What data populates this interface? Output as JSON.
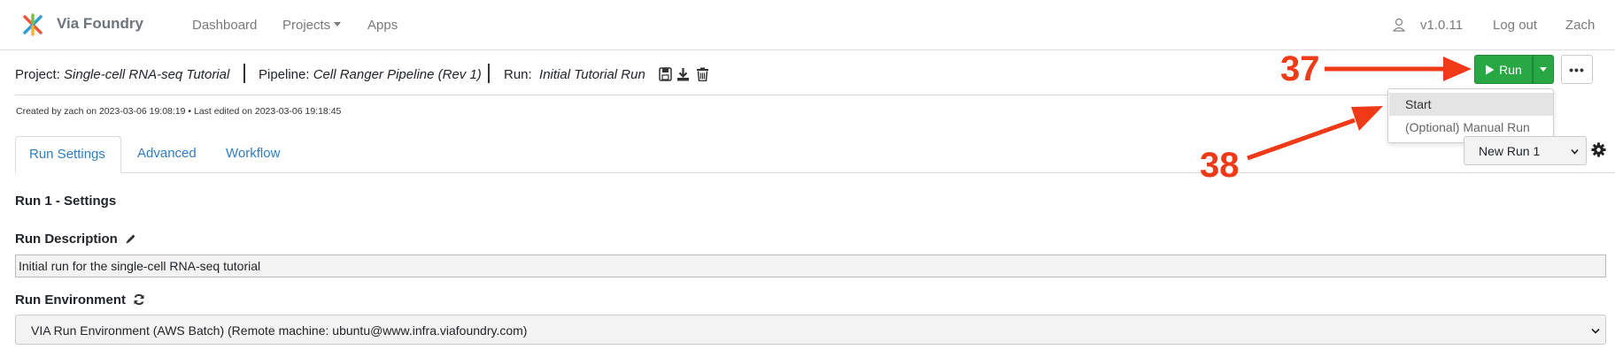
{
  "navbar": {
    "brand": "Via Foundry",
    "links": [
      "Dashboard",
      "Projects",
      "Apps"
    ],
    "version": "v1.0.11",
    "logout": "Log out",
    "user": "Zach"
  },
  "header": {
    "project_label": "Project:",
    "project_name": "Single-cell RNA-seq Tutorial",
    "pipeline_label": "Pipeline:",
    "pipeline_name": "Cell Ranger Pipeline (Rev 1)",
    "run_label": "Run:",
    "run_name": "Initial Tutorial Run",
    "meta": "Created by zach on 2023-03-06 19:08:19 • Last edited on 2023-03-06 19:18:45"
  },
  "run_button": {
    "label": "Run",
    "more": "•••"
  },
  "run_dropdown": {
    "items": [
      "Start",
      "(Optional) Manual Run"
    ],
    "highlighted": "Start"
  },
  "tabs": [
    "Run Settings",
    "Advanced",
    "Workflow"
  ],
  "active_tab": "Run Settings",
  "run_select": {
    "value": "New Run 1"
  },
  "settings": {
    "title": "Run 1 - Settings",
    "description_label": "Run Description",
    "description_value": "Initial run for the single-cell RNA-seq tutorial",
    "environment_label": "Run Environment",
    "environment_value": "VIA Run Environment (AWS Batch) (Remote machine: ubuntu@www.infra.viafoundry.com)"
  },
  "annotations": [
    "37",
    "38"
  ],
  "colors": {
    "accent": "#28a745",
    "link": "#2e7dbf",
    "annotation": "#f03a17"
  },
  "icons": [
    "user-icon",
    "save-icon",
    "download-icon",
    "trash-icon",
    "play-icon",
    "gear-icon",
    "pencil-icon",
    "refresh-icon"
  ]
}
